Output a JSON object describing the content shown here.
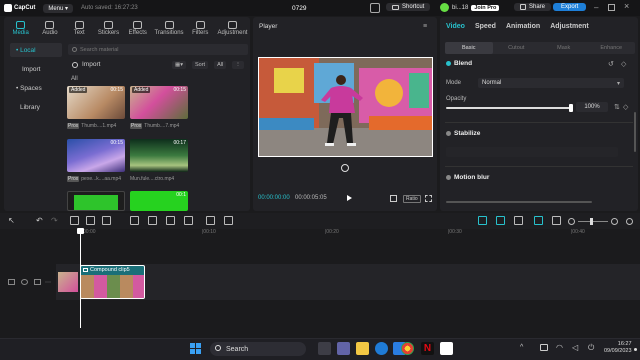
{
  "titlebar": {
    "app_name": "CapCut",
    "menu_label": "Menu",
    "autosave": "Auto saved: 16:27:23",
    "project_title": "0729",
    "shortcut_label": "Shortcut",
    "user_name": "bi...18",
    "join_pro_label": "Join Pro",
    "share_label": "Share",
    "export_label": "Export"
  },
  "media_panel": {
    "tabs": [
      {
        "label": "Media",
        "icon": "media-icon"
      },
      {
        "label": "Audio",
        "icon": "audio-icon"
      },
      {
        "label": "Text",
        "icon": "text-icon"
      },
      {
        "label": "Stickers",
        "icon": "stickers-icon"
      },
      {
        "label": "Effects",
        "icon": "effects-icon"
      },
      {
        "label": "Transitions",
        "icon": "transitions-icon"
      },
      {
        "label": "Filters",
        "icon": "filters-icon"
      },
      {
        "label": "Adjustment",
        "icon": "adjustment-icon"
      }
    ],
    "nav": [
      {
        "label": "• Local"
      },
      {
        "label": "Import"
      },
      {
        "label": "• Spaces"
      },
      {
        "label": "Library"
      }
    ],
    "search_placeholder": "Search material",
    "import_label": "Import",
    "sort_label": "Sort",
    "all_filter_label": "All",
    "all_label": "All",
    "items": [
      {
        "badge": "Added",
        "duration": "00:15",
        "tag": "Prox",
        "name": "Thumb....1.mp4"
      },
      {
        "badge": "Added",
        "duration": "00:15",
        "tag": "Prox",
        "name": "Thumb....7.mp4"
      },
      {
        "badge": "",
        "duration": "00:15",
        "tag": "Prox",
        "name": "pexe...k....aa.mp4"
      },
      {
        "badge": "",
        "duration": "00:17",
        "tag": "",
        "name": "Mun.fule....ctro.mp4"
      },
      {
        "badge": "",
        "duration": "",
        "tag": "",
        "name": ""
      },
      {
        "badge": "",
        "duration": "00:1",
        "tag": "",
        "name": ""
      }
    ]
  },
  "player": {
    "title": "Player",
    "time_current": "00:00:00:00",
    "time_total": "00:00:05:05",
    "ratio_label": "Ratio"
  },
  "props": {
    "tabs": [
      "Video",
      "Speed",
      "Animation",
      "Adjustment"
    ],
    "subtabs": [
      "Basic",
      "Cutout",
      "Mask",
      "Enhance"
    ],
    "blend_title": "Blend",
    "mode_label": "Mode",
    "mode_value": "Normal",
    "opacity_label": "Opacity",
    "opacity_value": "100%",
    "stabilize_title": "Stabilize",
    "motion_blur_title": "Motion blur"
  },
  "timeline": {
    "ticks": [
      "00:00",
      "|00:10",
      "|00:20",
      "|00:30",
      "|00:40"
    ],
    "clip_label": "Compound clip5",
    "clip_duration": "00:00:05:05"
  },
  "taskbar": {
    "search_label": "Search",
    "time": "16:27",
    "date": "09/09/2023"
  },
  "colors": {
    "accent": "#28c1cc",
    "export": "#1e7fd8",
    "clip": "#1a6f78"
  }
}
